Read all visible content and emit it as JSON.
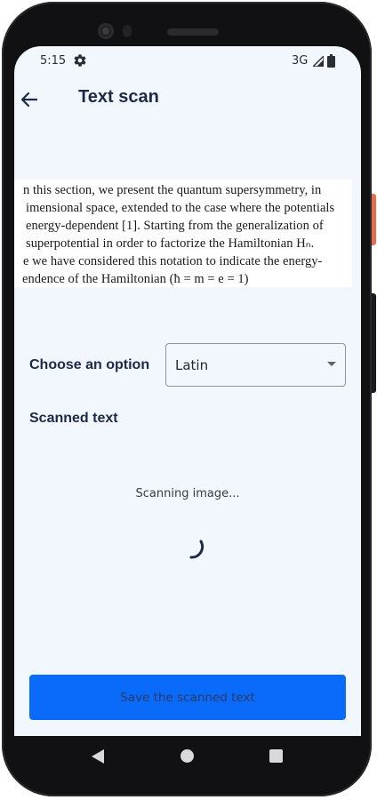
{
  "status_bar": {
    "time": "5:15",
    "network": "3G",
    "icons": [
      "gear-icon",
      "signal-icon",
      "battery-icon"
    ]
  },
  "app_bar": {
    "title": "Text scan",
    "back_icon": "arrow-left-icon"
  },
  "scanned_image": {
    "lines": [
      "n this section, we present the quantum supersymmetry, in",
      "imensional space, extended to the case where the potentials",
      "energy-dependent [1]. Starting from the generalization of",
      "superpotential in order to factorize the Hamiltonian Hₙ.",
      "e we have considered this notation to indicate the energy-",
      "endence of the Hamiltonian (ħ = m = e = 1)"
    ]
  },
  "option": {
    "label": "Choose an option",
    "selected": "Latin"
  },
  "scanned": {
    "heading": "Scanned text",
    "status": "Scanning image..."
  },
  "save_button": {
    "label": "Save the scanned text"
  },
  "colors": {
    "background": "#f2f6fd",
    "primary_button": "#0a6bfa",
    "title_text": "#1d2a47",
    "spinner": "#1d2a47"
  },
  "nav_bar": {
    "icons": [
      "back-triangle-icon",
      "home-circle-icon",
      "recents-square-icon"
    ]
  }
}
